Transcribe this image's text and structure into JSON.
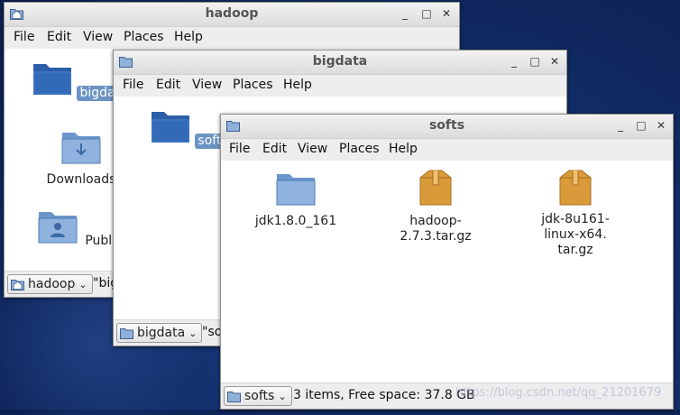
{
  "windows": {
    "hadoop": {
      "title": "hadoop",
      "menu": [
        "File",
        "Edit",
        "View",
        "Places",
        "Help"
      ],
      "items": [
        {
          "label": "bigdata",
          "icon": "folder-icon"
        },
        {
          "label": "Downloads",
          "icon": "downloads-folder-icon"
        },
        {
          "label": "Public",
          "icon": "public-folder-icon"
        }
      ],
      "path": "hadoop",
      "status": "\"big"
    },
    "bigdata": {
      "title": "bigdata",
      "menu": [
        "File",
        "Edit",
        "View",
        "Places",
        "Help"
      ],
      "items": [
        {
          "label": "softs",
          "icon": "folder-icon"
        }
      ],
      "path": "bigdata",
      "status": "\"so"
    },
    "softs": {
      "title": "softs",
      "menu": [
        "File",
        "Edit",
        "View",
        "Places",
        "Help"
      ],
      "items": [
        {
          "label": "jdk1.8.0_161",
          "icon": "folder-icon"
        },
        {
          "label": "hadoop-2.7.3.tar.gz",
          "icon": "archive-icon"
        },
        {
          "label_line1": "jdk-8u161-linux-x64.",
          "label_line2": "tar.gz",
          "icon": "archive-icon"
        }
      ],
      "path": "softs",
      "status": "3 items, Free space: 37.8 GB"
    }
  },
  "watermark": "https://blog.csdn.net/qq_21201679",
  "colors": {
    "selection": "#6b94c4",
    "folder_blue": "#5b86c2",
    "archive_orange": "#d99a3a"
  }
}
